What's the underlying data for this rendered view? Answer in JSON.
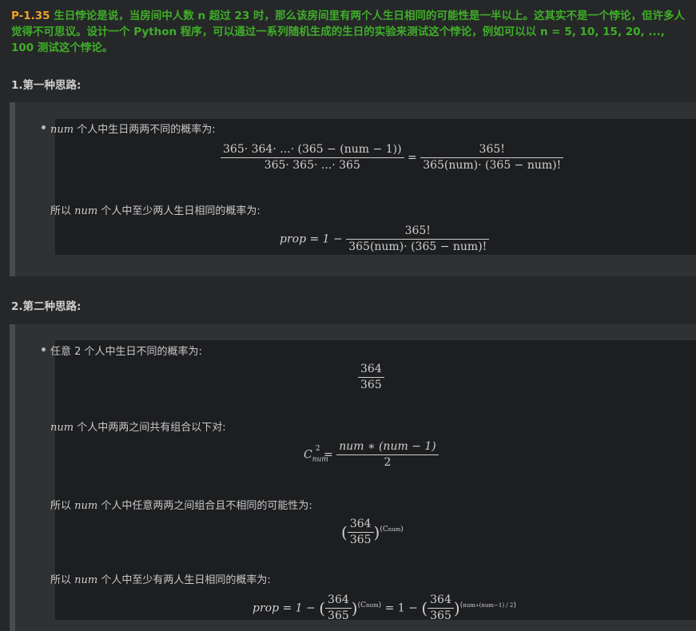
{
  "problem": {
    "id": "P-1.35",
    "text": "生日悖论是说，当房间中人数 n 超过 23 时，那么该房间里有两个人生日相同的可能性是一半以上。这其实不是一个悖论，但许多人觉得不可思议。设计一个 Python 程序，可以通过一系列随机生成的生日的实验来测试这个悖论，例如可以以 n = 5, 10, 15, 20, ..., 100 测试这个悖论。"
  },
  "section1": {
    "heading": "1.第一种思路:",
    "bullet_var": "num",
    "bullet_text": " 个人中生日两两不同的概率为:",
    "eq1_num": "365· 364· ...· (365 − (num − 1))",
    "eq1_den": "365· 365· ...· 365",
    "eq1_rnum": "365!",
    "eq1_rden": "365(num)· (365 − num)!",
    "line2_pre": "所以 ",
    "line2_var": "num",
    "line2_post": " 个人中至少两人生日相同的概率为:",
    "eq2_lhs": "prop = 1 −",
    "eq2_num": "365!",
    "eq2_den": "365(num)· (365 − num)!"
  },
  "section2": {
    "heading": "2.第二种思路:",
    "bullet_text": "任意 2 个人中生日不同的概率为:",
    "frac_num": "364",
    "frac_den": "365",
    "line2_var": "num",
    "line2_post": " 个人中两两之间共有组合以下对:",
    "comb_lhs": "C",
    "comb_num": "num ∗ (num − 1)",
    "comb_den": "2",
    "line3_pre": "所以 ",
    "line3_var": "num",
    "line3_post": " 个人中任意两两之间组合且不相同的可能性为:",
    "line4_pre": "所以 ",
    "line4_var": "num",
    "line4_post": " 个人中至少有两人生日相同的概率为:",
    "final_lhs": "prop = 1 − "
  }
}
